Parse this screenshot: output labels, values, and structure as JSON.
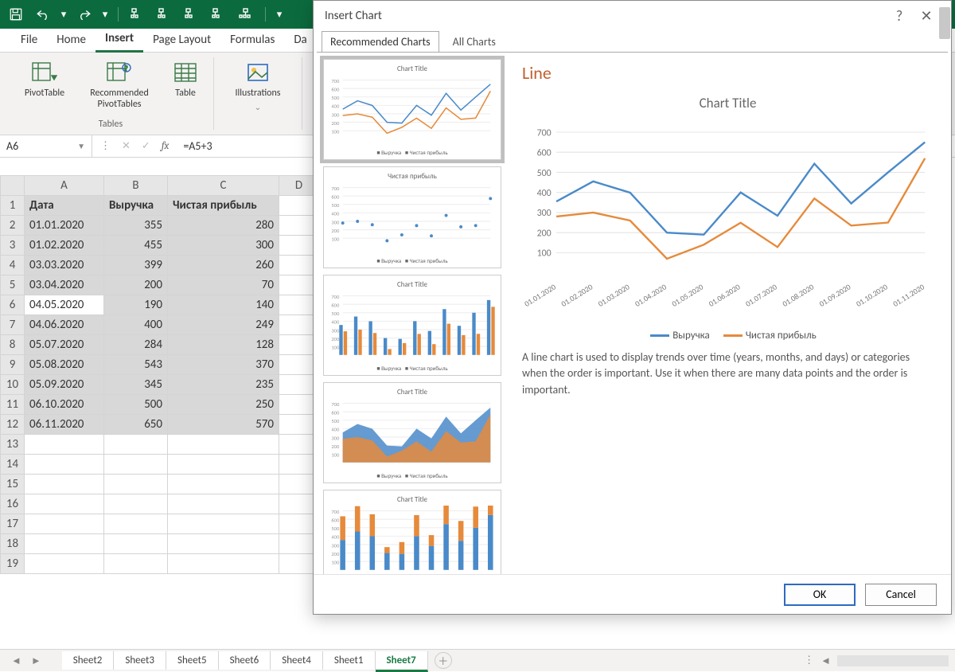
{
  "titlebar": {
    "tooltip_save": "Save",
    "tooltip_undo": "Undo",
    "tooltip_redo": "Redo"
  },
  "ribbonTabs": [
    "File",
    "Home",
    "Insert",
    "Page Layout",
    "Formulas",
    "Da"
  ],
  "ribbonActive": "Insert",
  "ribbon": {
    "tables_group": "Tables",
    "pivottable": "PivotTable",
    "recommended_pt": "Recommended PivotTables",
    "table": "Table",
    "illustrations": "Illustrations"
  },
  "nameBox": "A6",
  "formula": "=A5+3",
  "cols": [
    "A",
    "B",
    "C",
    "D"
  ],
  "headers": [
    "Дата",
    "Выручка",
    "Чистая прибыль"
  ],
  "rows": [
    [
      "01.01.2020",
      "355",
      "280"
    ],
    [
      "01.02.2020",
      "455",
      "300"
    ],
    [
      "03.03.2020",
      "399",
      "260"
    ],
    [
      "03.04.2020",
      "200",
      "70"
    ],
    [
      "04.05.2020",
      "190",
      "140"
    ],
    [
      "04.06.2020",
      "400",
      "249"
    ],
    [
      "05.07.2020",
      "284",
      "128"
    ],
    [
      "05.08.2020",
      "543",
      "370"
    ],
    [
      "05.09.2020",
      "345",
      "235"
    ],
    [
      "06.10.2020",
      "500",
      "250"
    ],
    [
      "06.11.2020",
      "650",
      "570"
    ]
  ],
  "sheets": [
    "Sheet2",
    "Sheet3",
    "Sheet5",
    "Sheet6",
    "Sheet4",
    "Sheet1",
    "Sheet7"
  ],
  "activeSheet": "Sheet7",
  "dialog": {
    "title": "Insert Chart",
    "tab1": "Recommended Charts",
    "tab2": "All Charts",
    "thumb_titles": [
      "Chart Title",
      "Чистая прибыль",
      "Chart Title",
      "Chart Title",
      "Chart Title"
    ],
    "thumb_legend": "Выручка — Чистая прибыль",
    "chartType": "Line",
    "chartTitle": "Chart Title",
    "legend1": "Выручка",
    "legend2": "Чистая прибыль",
    "desc": "A line chart is used to display trends over time (years, months, and days) or categories when the order is important. Use it when there are many data points and the order is important.",
    "ok": "OK",
    "cancel": "Cancel"
  },
  "chart_data": {
    "type": "line",
    "title": "Chart Title",
    "categories": [
      "01.01.2020",
      "01.02.2020",
      "01.03.2020",
      "01.04.2020",
      "01.05.2020",
      "01.06.2020",
      "01.07.2020",
      "01.08.2020",
      "01.09.2020",
      "01.10.2020",
      "01.11.2020"
    ],
    "series": [
      {
        "name": "Выручка",
        "color": "#4a8ac9",
        "values": [
          355,
          455,
          399,
          200,
          190,
          400,
          284,
          543,
          345,
          500,
          650
        ]
      },
      {
        "name": "Чистая прибыль",
        "color": "#e68a3b",
        "values": [
          280,
          300,
          260,
          70,
          140,
          249,
          128,
          370,
          235,
          250,
          570
        ]
      }
    ],
    "ylim": [
      0,
      700
    ],
    "yticks": [
      100,
      200,
      300,
      400,
      500,
      600,
      700
    ]
  }
}
